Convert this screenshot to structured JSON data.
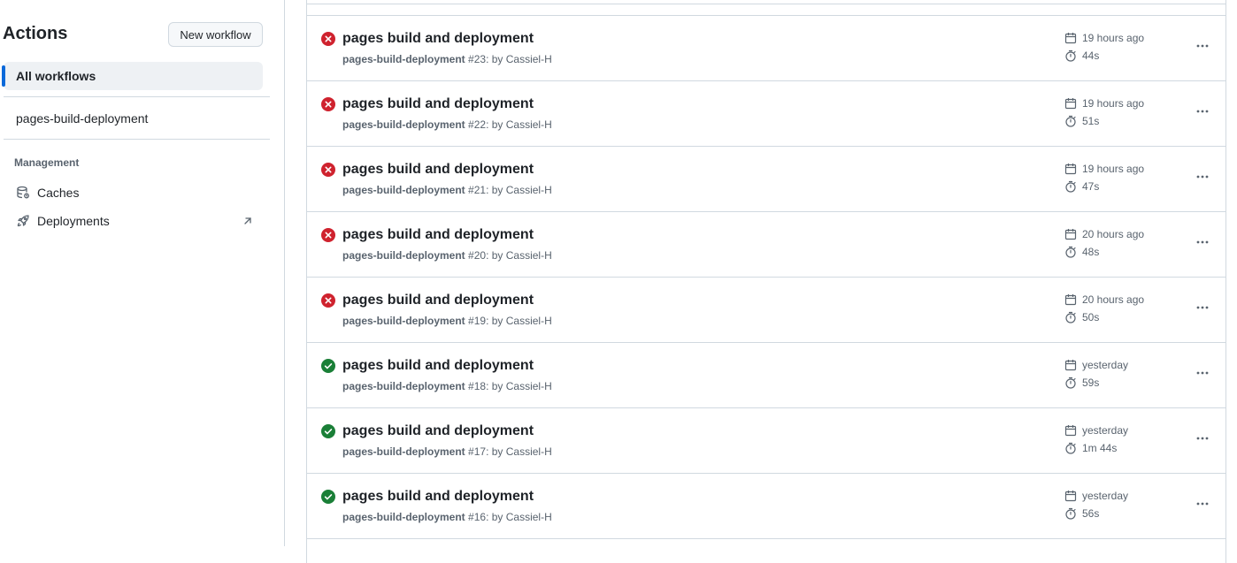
{
  "sidebar": {
    "title": "Actions",
    "new_workflow_label": "New workflow",
    "all_workflows_label": "All workflows",
    "workflows": [
      {
        "label": "pages-build-deployment"
      }
    ],
    "management_label": "Management",
    "management_items": [
      {
        "label": "Caches",
        "icon": "database-icon"
      },
      {
        "label": "Deployments",
        "icon": "rocket-icon",
        "external_icon": "arrow-up-right-icon"
      }
    ]
  },
  "colors": {
    "failure": "#cf222e",
    "success": "#1a7f37",
    "accent": "#0969da",
    "muted": "#59636e",
    "border": "#d1d9e0"
  },
  "runs": [
    {
      "status": "failure",
      "title": "pages build and deployment",
      "workflow": "pages-build-deployment",
      "number": "#23",
      "actor_text": ": by Cassiel-H",
      "when": "19 hours ago",
      "duration": "44s"
    },
    {
      "status": "failure",
      "title": "pages build and deployment",
      "workflow": "pages-build-deployment",
      "number": "#22",
      "actor_text": ": by Cassiel-H",
      "when": "19 hours ago",
      "duration": "51s"
    },
    {
      "status": "failure",
      "title": "pages build and deployment",
      "workflow": "pages-build-deployment",
      "number": "#21",
      "actor_text": ": by Cassiel-H",
      "when": "19 hours ago",
      "duration": "47s"
    },
    {
      "status": "failure",
      "title": "pages build and deployment",
      "workflow": "pages-build-deployment",
      "number": "#20",
      "actor_text": ": by Cassiel-H",
      "when": "20 hours ago",
      "duration": "48s"
    },
    {
      "status": "failure",
      "title": "pages build and deployment",
      "workflow": "pages-build-deployment",
      "number": "#19",
      "actor_text": ": by Cassiel-H",
      "when": "20 hours ago",
      "duration": "50s"
    },
    {
      "status": "success",
      "title": "pages build and deployment",
      "workflow": "pages-build-deployment",
      "number": "#18",
      "actor_text": ": by Cassiel-H",
      "when": "yesterday",
      "duration": "59s"
    },
    {
      "status": "success",
      "title": "pages build and deployment",
      "workflow": "pages-build-deployment",
      "number": "#17",
      "actor_text": ": by Cassiel-H",
      "when": "yesterday",
      "duration": "1m 44s"
    },
    {
      "status": "success",
      "title": "pages build and deployment",
      "workflow": "pages-build-deployment",
      "number": "#16",
      "actor_text": ": by Cassiel-H",
      "when": "yesterday",
      "duration": "56s"
    }
  ]
}
